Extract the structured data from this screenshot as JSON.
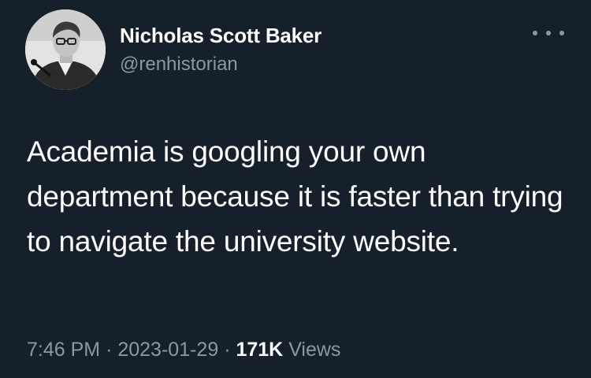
{
  "author": {
    "display_name": "Nicholas Scott Baker",
    "handle": "@renhistorian",
    "avatar_icon": "profile-photo"
  },
  "more_icon": "more-horizontal-icon",
  "tweet": {
    "text": "Academia is googling your own department because it is faster than trying to navigate the university website."
  },
  "meta": {
    "time": "7:46 PM",
    "separator": "·",
    "date": "2023-01-29",
    "views_count": "171K",
    "views_label": "Views"
  },
  "colors": {
    "background": "#15202b",
    "primary_text": "#ffffff",
    "secondary_text": "#8899a6"
  }
}
